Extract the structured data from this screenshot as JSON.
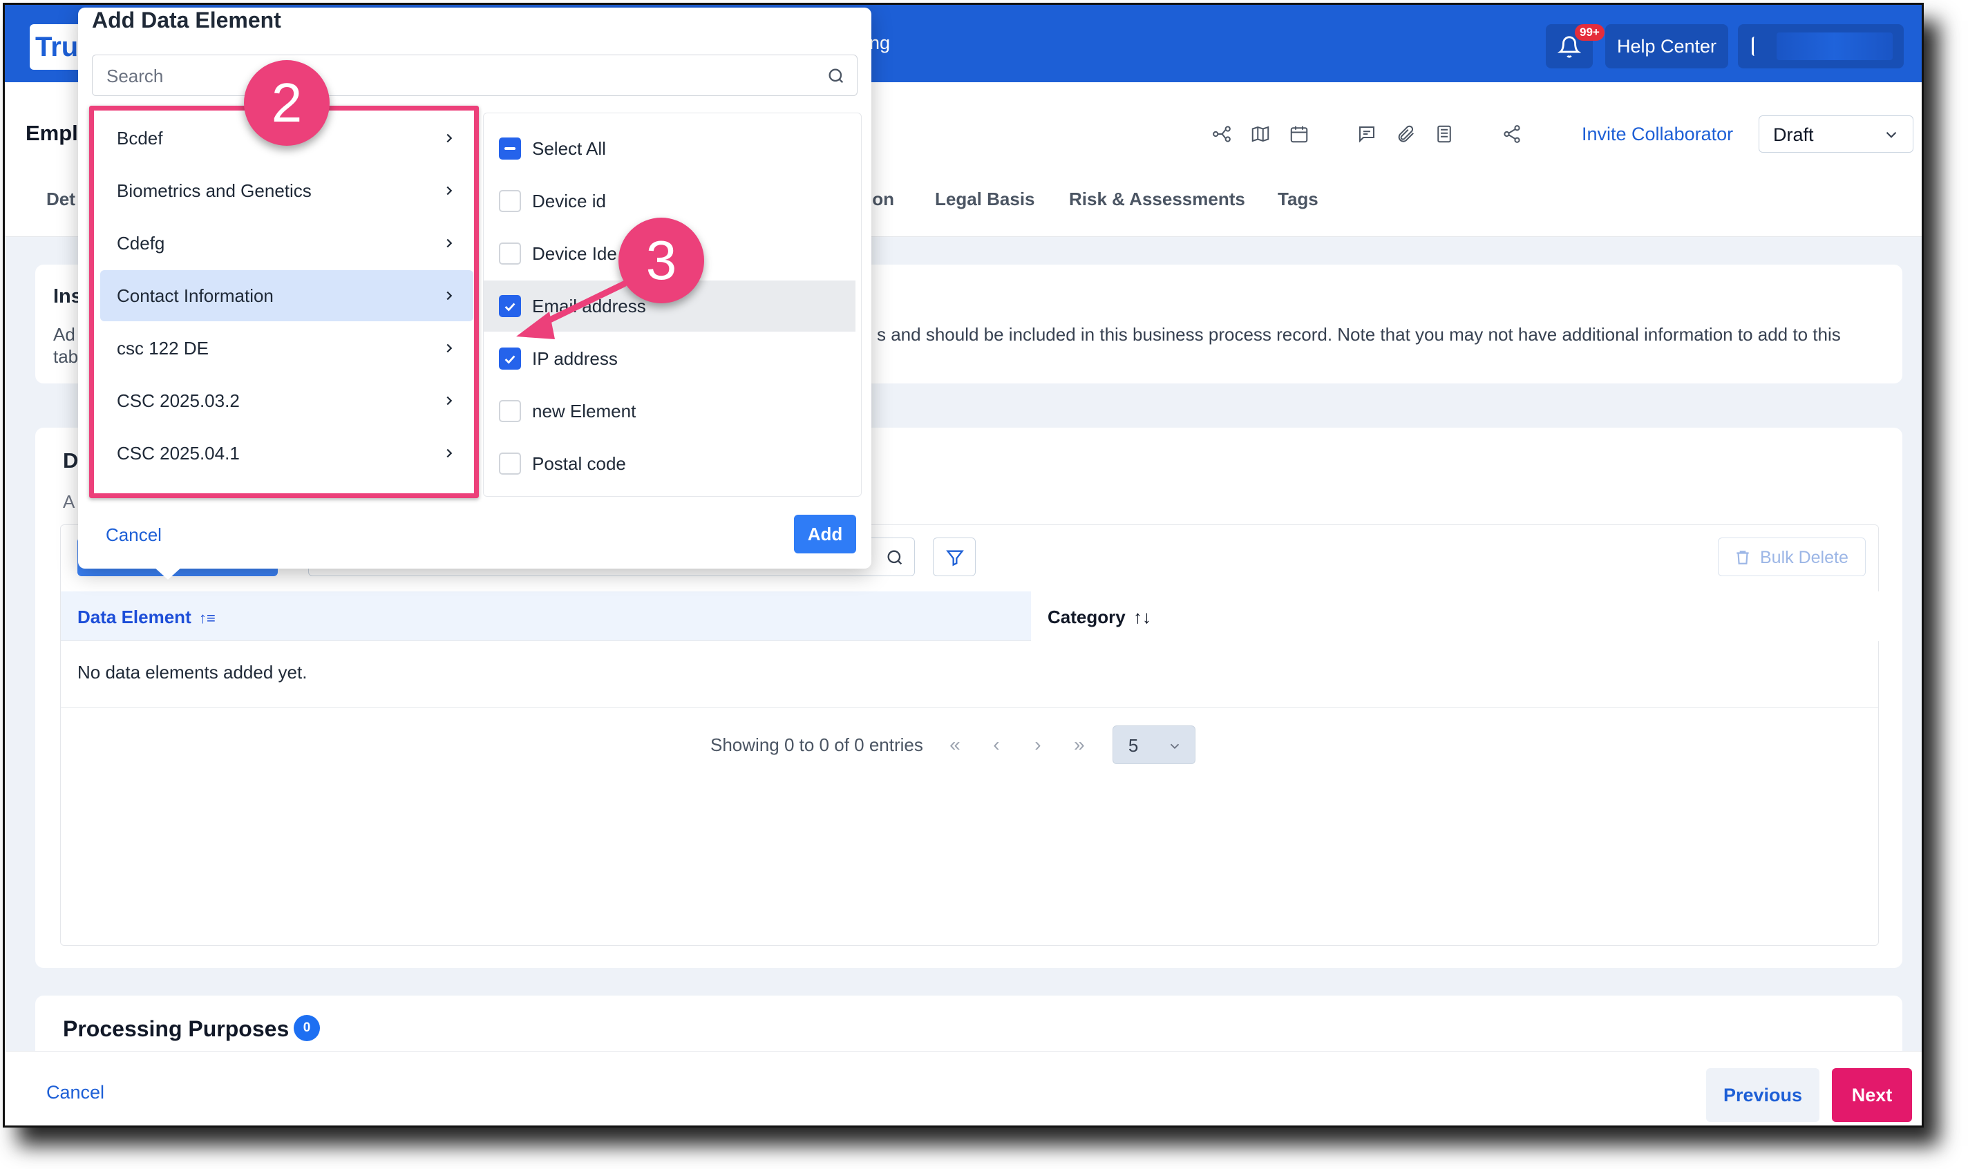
{
  "app": {
    "logo_text": "Trus",
    "header_partial": "ding",
    "notification_badge": "99+",
    "help_center": "Help Center"
  },
  "page": {
    "title": "Empl",
    "invite": "Invite Collaborator",
    "status": "Draft"
  },
  "tabs": [
    "Det",
    "ion",
    "Legal Basis",
    "Risk & Assessments",
    "Tags"
  ],
  "instructions": {
    "heading": "Ins",
    "line1": "Ad",
    "line2": "tab",
    "text": "s and should be included in this business process record. Note that you may not have additional information to add to this"
  },
  "data_elements": {
    "heading": "D",
    "sub": "A",
    "bulk_delete": "Bulk Delete",
    "col_data_element": "Data Element",
    "col_category": "Category",
    "empty": "No data elements added yet.",
    "showing": "Showing 0 to 0 of 0 entries",
    "page_size": "5",
    "pager": {
      "first": "«",
      "prev": "‹",
      "next": "›",
      "last": "»"
    }
  },
  "processing_purposes": {
    "heading": "Processing Purposes",
    "count": "0"
  },
  "footer": {
    "cancel": "Cancel",
    "previous": "Previous",
    "next": "Next"
  },
  "modal": {
    "title": "Add Data Element",
    "search_placeholder": "Search",
    "categories": [
      "Bcdef",
      "Biometrics and Genetics",
      "Cdefg",
      "Contact Information",
      "csc 122 DE",
      "CSC 2025.03.2",
      "CSC 2025.04.1"
    ],
    "active_category": "Contact Information",
    "options": [
      {
        "label": "Select All",
        "state": "indeterminate"
      },
      {
        "label": "Device id",
        "state": "unchecked"
      },
      {
        "label": "Device Ide",
        "state": "unchecked"
      },
      {
        "label": "Email address",
        "state": "checked"
      },
      {
        "label": "IP address",
        "state": "checked"
      },
      {
        "label": "new Element",
        "state": "unchecked"
      },
      {
        "label": "Postal code",
        "state": "unchecked"
      }
    ],
    "cancel": "Cancel",
    "add": "Add"
  },
  "annotations": {
    "step2": "2",
    "step3": "3",
    "accent_color": "#ec407a"
  },
  "colors": {
    "brand_blue": "#1d5fd6",
    "next_pink": "#e3196b"
  }
}
